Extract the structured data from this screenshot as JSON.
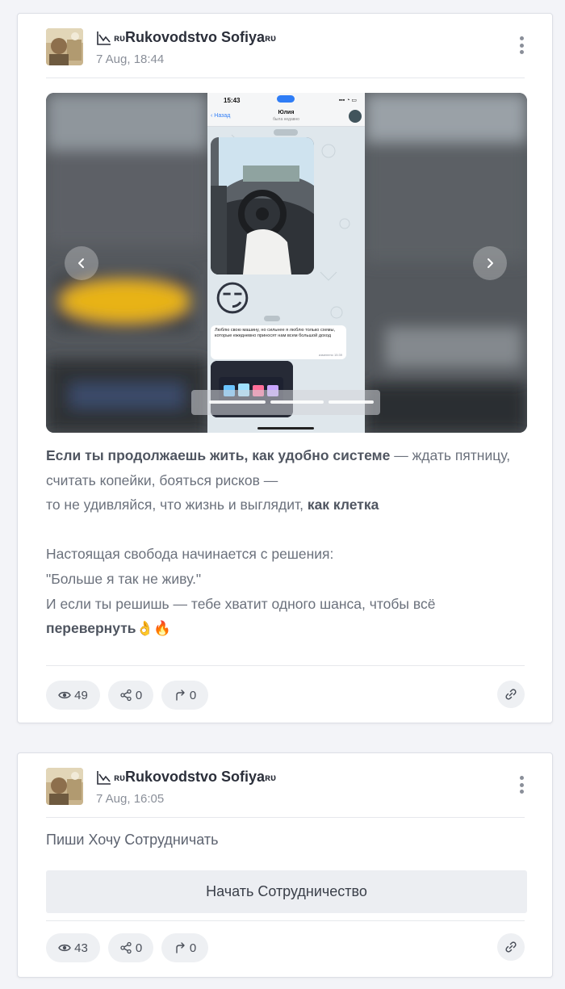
{
  "posts": [
    {
      "author_prefix": "ʀᴜ",
      "author_name": "Rukovodstvo Sofiya",
      "author_suffix": "ʀᴜ",
      "date": "7 Aug, 18:44",
      "media": {
        "phone_time": "15:43",
        "chat_back": "Назад",
        "chat_name": "Юлия",
        "chat_status": "была недавно",
        "emoji": "😏",
        "message_text": "Люблю свою машину, но сильнее я люблю только схемы, которые ежедневно приносят нам всем большой доход",
        "message_time": "изменено 15:39"
      },
      "text": {
        "p1_bold": "Если ты продолжаешь жить, как удобно системе",
        "p1_rest": " — ждать пятницу, считать копейки, бояться рисков —",
        "p2_start": "то не удивляйся, что жизнь и выглядит, ",
        "p2_bold": "как клетка",
        "p3": "Настоящая свобода начинается с решения:",
        "p4": "\"Больше я так не живу.\"",
        "p5": "И если ты решишь — тебе хватит одного шанса, чтобы всё",
        "p6_bold": "перевернуть",
        "p6_emoji": "👌🔥"
      },
      "stats": {
        "views": "49",
        "shares": "0",
        "forwards": "0"
      }
    },
    {
      "author_prefix": "ʀᴜ",
      "author_name": "Rukovodstvo Sofiya",
      "author_suffix": "ʀᴜ",
      "date": "7 Aug, 16:05",
      "text": "Пиши Хочу Сотрудничать",
      "button_label": "Начать Сотрудничество",
      "stats": {
        "views": "43",
        "shares": "0",
        "forwards": "0"
      }
    }
  ],
  "icons": {
    "menu": "more-vertical-icon",
    "views": "eye-icon",
    "shares": "share-icon",
    "forwards": "forward-icon",
    "link": "link-icon",
    "prev": "chevron-left-icon",
    "next": "chevron-right-icon"
  },
  "colors": {
    "background": "#f3f4f8",
    "card": "#ffffff",
    "chip": "#eef0f3",
    "muted": "#8a8f99"
  }
}
